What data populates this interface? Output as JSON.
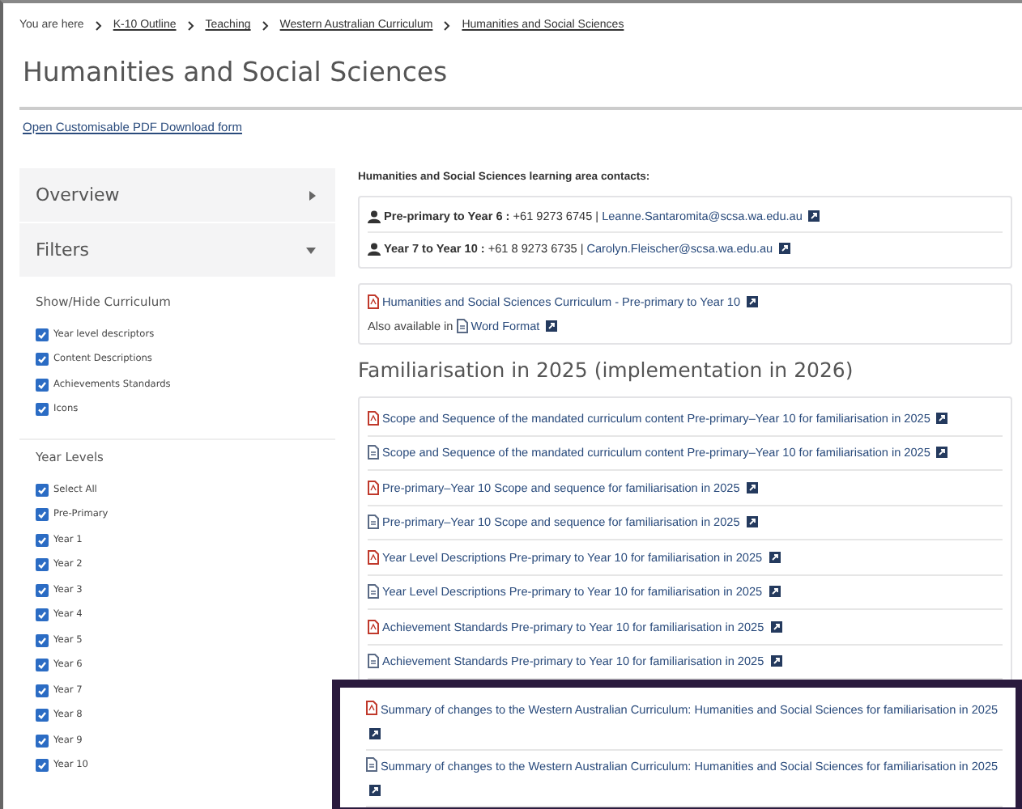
{
  "breadcrumb": {
    "lead": "You are here",
    "items": [
      "K-10 Outline",
      "Teaching",
      "Western Australian Curriculum",
      "Humanities and Social Sciences"
    ]
  },
  "title": "Humanities and Social Sciences",
  "pdf_form_link": "Open Customisable PDF Download form",
  "sidebar": {
    "panels": [
      {
        "label": "Overview",
        "expanded": false
      },
      {
        "label": "Filters",
        "expanded": true
      }
    ],
    "groups": [
      {
        "heading": "Show/Hide Curriculum",
        "options": [
          {
            "label": "Year level descriptors",
            "checked": true
          },
          {
            "label": "Content Descriptions",
            "checked": true
          },
          {
            "label": "Achievements Standards",
            "checked": true
          },
          {
            "label": "Icons",
            "checked": true
          }
        ]
      },
      {
        "heading": "Year Levels",
        "options": [
          {
            "label": "Select All",
            "checked": true
          },
          {
            "label": "Pre-Primary",
            "checked": true
          },
          {
            "label": "Year 1",
            "checked": true
          },
          {
            "label": "Year 2",
            "checked": true
          },
          {
            "label": "Year 3",
            "checked": true
          },
          {
            "label": "Year 4",
            "checked": true
          },
          {
            "label": "Year 5",
            "checked": true
          },
          {
            "label": "Year 6",
            "checked": true
          },
          {
            "label": "Year 7",
            "checked": true
          },
          {
            "label": "Year 8",
            "checked": true
          },
          {
            "label": "Year 9",
            "checked": true
          },
          {
            "label": "Year 10",
            "checked": true
          }
        ]
      }
    ]
  },
  "contacts": {
    "heading": "Humanities and Social Sciences learning area contacts:",
    "separator": "|",
    "items": [
      {
        "role": "Pre-primary to Year 6 :",
        "phone": "+61 9273 6745",
        "email": "Leanne.Santaromita@scsa.wa.edu.au"
      },
      {
        "role": "Year 7 to Year 10 :",
        "phone": "+61 8 9273 6735",
        "email": "Carolyn.Fleischer@scsa.wa.edu.au"
      }
    ]
  },
  "curriculum_box": {
    "link": {
      "label": "Humanities and Social Sciences Curriculum - Pre-primary to Year 10",
      "kind": "pdf"
    },
    "also_text": "Also available in",
    "alt_link": {
      "label": "Word Format",
      "kind": "word"
    }
  },
  "section_heading": "Familiarisation in 2025 (implementation in 2026)",
  "documents": [
    {
      "label": "Scope and Sequence of the mandated curriculum content Pre-primary–Year 10 for familiarisation in 2025",
      "kind": "pdf",
      "highlighted": false
    },
    {
      "label": "Scope and Sequence of the mandated curriculum content Pre-primary–Year 10 for familiarisation in 2025",
      "kind": "word",
      "highlighted": false
    },
    {
      "label": "Pre-primary–Year 10 Scope and sequence for familiarisation in 2025",
      "kind": "pdf",
      "highlighted": false
    },
    {
      "label": "Pre-primary–Year 10 Scope and sequence for familiarisation in 2025",
      "kind": "word",
      "highlighted": false
    },
    {
      "label": "Year Level Descriptions Pre-primary to Year 10 for familiarisation in 2025",
      "kind": "pdf",
      "highlighted": false
    },
    {
      "label": "Year Level Descriptions Pre-primary to Year 10 for familiarisation in 2025",
      "kind": "word",
      "highlighted": false
    },
    {
      "label": "Achievement Standards Pre-primary to Year 10 for familiarisation in 2025",
      "kind": "pdf",
      "highlighted": false
    },
    {
      "label": "Achievement Standards Pre-primary to Year 10 for familiarisation in 2025",
      "kind": "word",
      "highlighted": false
    },
    {
      "label": "Summary of changes to the Western Australian Curriculum: Humanities and Social Sciences for familiarisation in 2025",
      "kind": "pdf",
      "highlighted": true
    },
    {
      "label": "Summary of changes to the Western Australian Curriculum: Humanities and Social Sciences for familiarisation in 2025",
      "kind": "word",
      "highlighted": true
    }
  ]
}
